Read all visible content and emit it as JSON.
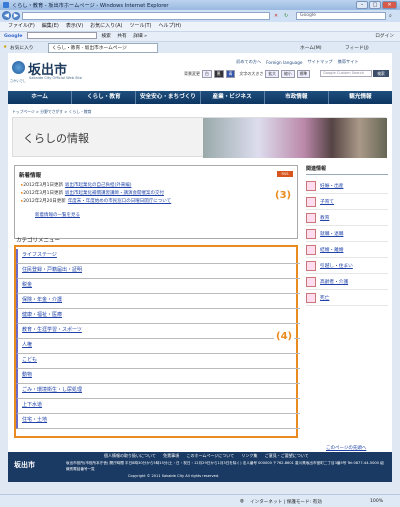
{
  "browser": {
    "title": "くらし・教育 - 坂出市ホームページ - Windows Internet Explorer",
    "address": "",
    "search_placeholder": "Google",
    "menu": [
      "ファイル(F)",
      "編集(E)",
      "表示(V)",
      "お気に入り(A)",
      "ツール(T)",
      "ヘルプ(H)"
    ],
    "google_bar": [
      "Google",
      "検索",
      "共有",
      "詳細 »",
      "ログイン"
    ],
    "favorites_label": "お気に入り",
    "tab_label": "くらし・教育 - 坂出市ホームページ",
    "toolbar": [
      "ホーム(M)",
      "フィード(J)"
    ],
    "status_text": "インターネット | 保護モード: 有効",
    "zoom": "100%"
  },
  "site": {
    "title": "坂出市",
    "subtitle": "Sakaide City Official Web Site",
    "logo_sub": "さかいでし",
    "top_links": [
      "初めての方へ",
      "Foreign language",
      "サイトマップ",
      "携帯サイト"
    ],
    "tools_label": "背景変更",
    "tools_text": "文字の大きさ",
    "tool_buttons": [
      "白",
      "黒",
      "青",
      "拡大",
      "縮小",
      "標準"
    ],
    "search_placeholder": "Google Custom Search",
    "search_button": "検索",
    "nav": [
      "ホーム",
      "くらし・教育",
      "安全安心・まちづくり",
      "産業・ビジネス",
      "市政情報",
      "観光情報"
    ],
    "breadcrumb": "トップページ > 分野でさがす > くらし・教育",
    "hero_title": "くらしの情報"
  },
  "news": {
    "heading": "新着情報",
    "badge": "RSS",
    "items": [
      {
        "date": "2012年3月1日更新",
        "link": "坂出市起業化の自己負担(外来編)"
      },
      {
        "date": "2012年3月1日更新",
        "link": "坂出市起業化補償講習講師・講演会開催案の交付"
      },
      {
        "date": "2012年2月20日更新",
        "link": "年度末・年度始めの市民窓口の日曜日開庁について"
      }
    ],
    "more": "新着情報の一覧を見る",
    "callout": "(3)"
  },
  "category": {
    "heading": "カテゴリメニュー",
    "items": [
      "ライフステージ",
      "住民登録・戸籍届出・証明",
      "税金",
      "保険・年金・介護",
      "健康・福祉・医療",
      "教育・生涯学習・スポーツ",
      "人権",
      "こども",
      "動物",
      "ごみ・環境衛生・し尿処理",
      "上下水道",
      "住宅・土地"
    ],
    "callout": "(4)"
  },
  "side": {
    "heading": "関連情報",
    "items": [
      "妊娠・出産",
      "子育て",
      "教育",
      "就職・退職",
      "結婚・離婚",
      "引越し・住まい",
      "高齢者・介護",
      "死亡"
    ]
  },
  "to_top": "このページの先頭へ",
  "footer": {
    "links": [
      "個人情報の取り扱いについて",
      "免責事項",
      "このホームページについて",
      "リンク集",
      "ご意見・ご要望について"
    ],
    "logo": "坂出市",
    "address": "坂出市役所(市役所本庁舎) 開庁時間 平日8時30分から5時15分(土・日・祝日・12月29日から1月3日を除く) 法人番号 000000 〒762-8601 香川県坂出市室町二丁目3番5号 Tel:0877-44-5000 組織別電話番号一覧",
    "copyright": "Copyright © 2011 Sakaide City All rights reserved."
  }
}
